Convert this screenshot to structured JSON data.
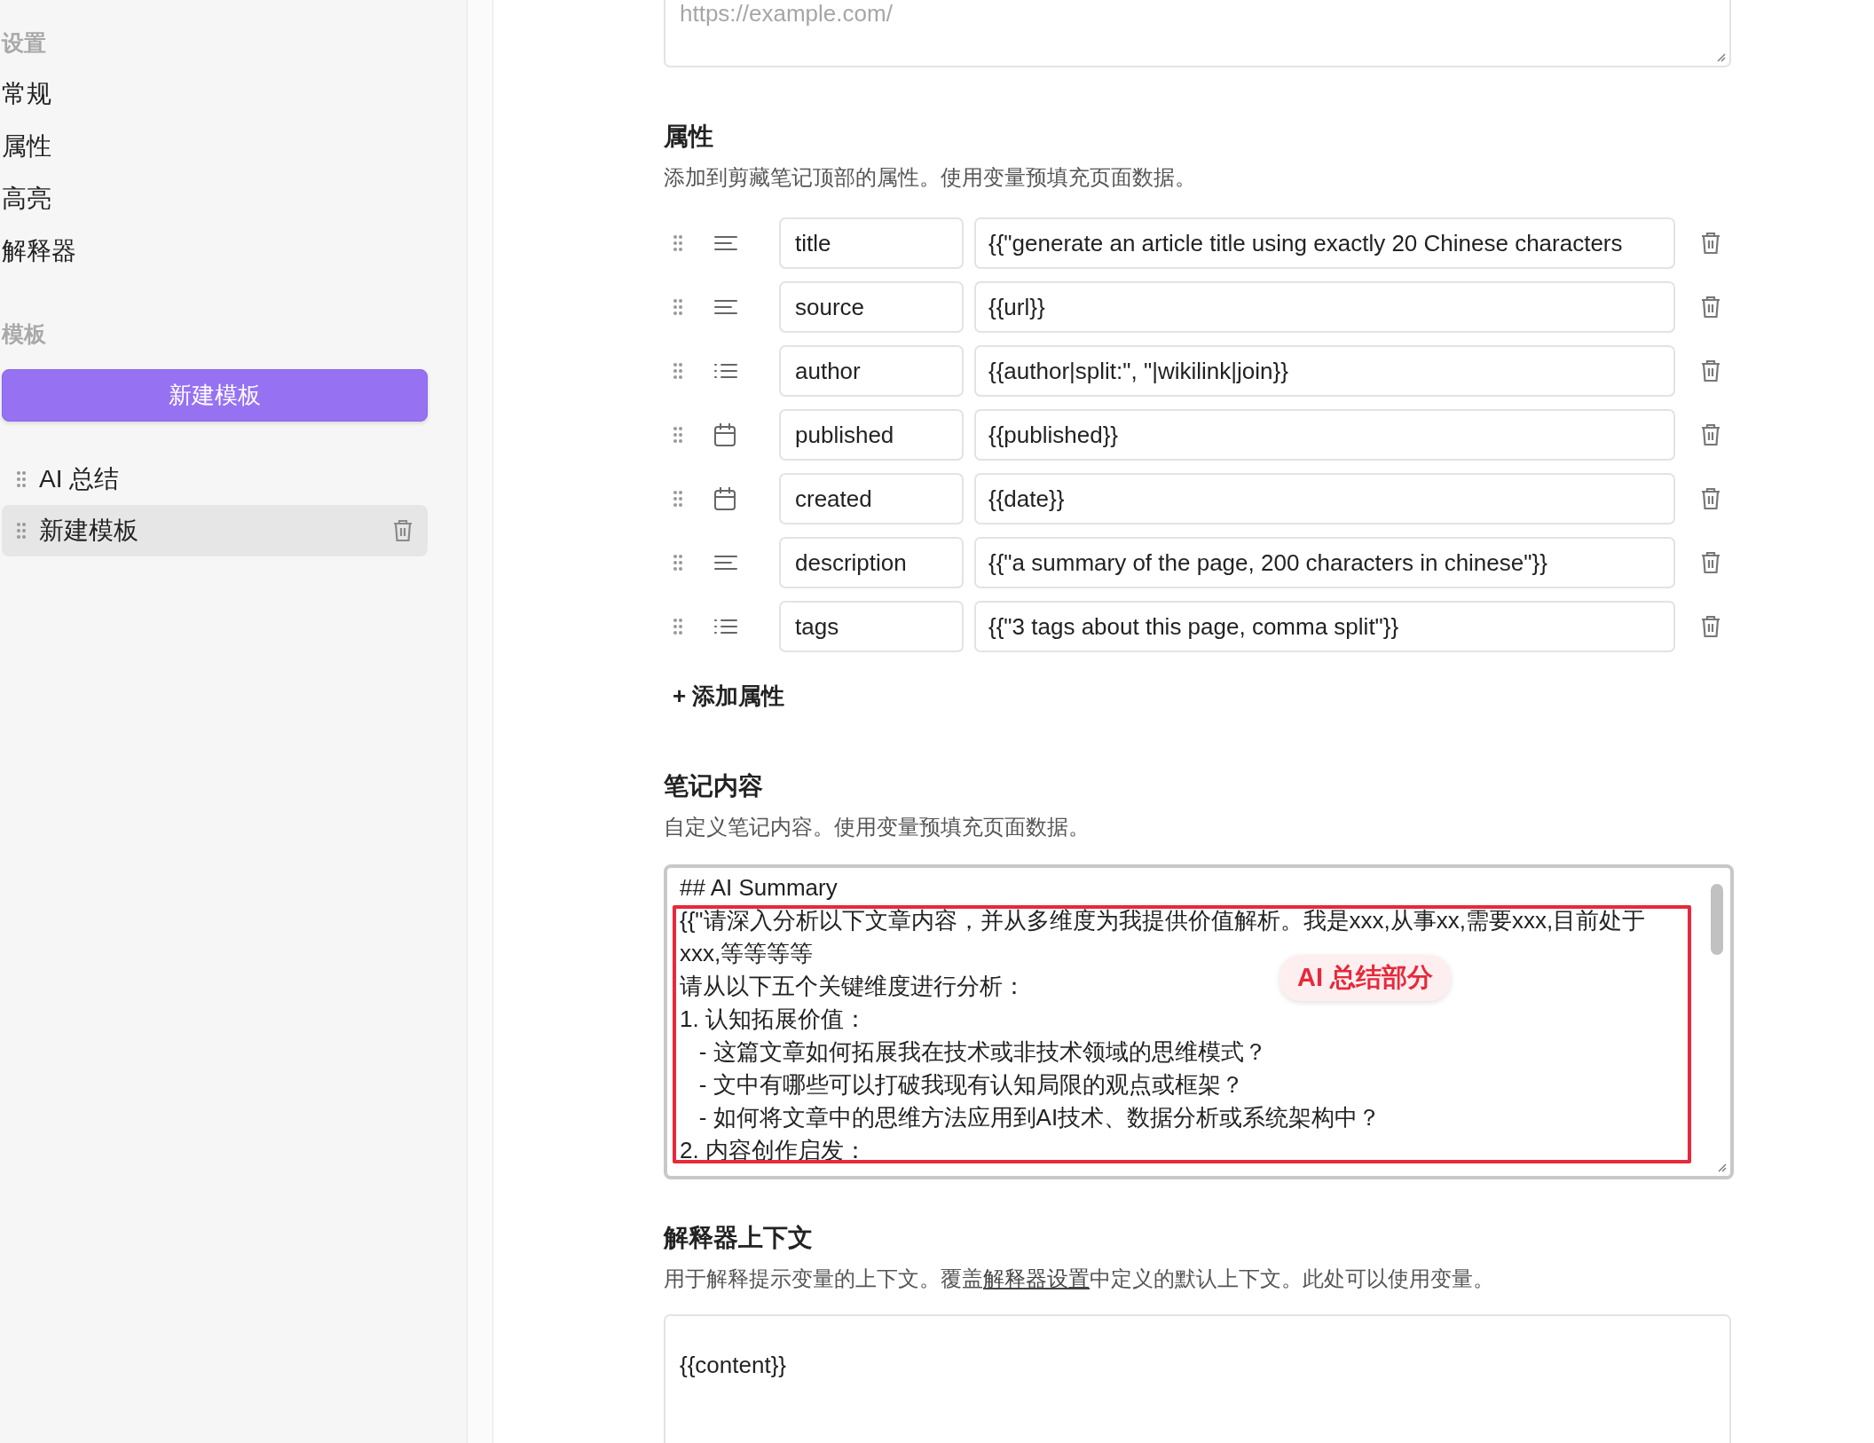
{
  "sidebar": {
    "sections": [
      {
        "heading": "设置",
        "items": [
          {
            "label": "常规"
          },
          {
            "label": "属性"
          },
          {
            "label": "高亮"
          },
          {
            "label": "解释器"
          }
        ]
      },
      {
        "heading": "模板"
      }
    ],
    "new_template_button": "新建模板",
    "templates": [
      {
        "label": "AI 总结",
        "selected": false
      },
      {
        "label": "新建模板",
        "selected": true
      }
    ]
  },
  "url_field": {
    "placeholder": "https://example.com/"
  },
  "properties": {
    "title": "属性",
    "description": "添加到剪藏笔记顶部的属性。使用变量预填充页面数据。",
    "rows": [
      {
        "kind": "text",
        "name": "title",
        "value": "{{\"generate an article title using exactly 20 Chinese characters"
      },
      {
        "kind": "text",
        "name": "source",
        "value": "{{url}}"
      },
      {
        "kind": "list",
        "name": "author",
        "value": "{{author|split:\", \"|wikilink|join}}"
      },
      {
        "kind": "date",
        "name": "published",
        "value": "{{published}}"
      },
      {
        "kind": "date",
        "name": "created",
        "value": "{{date}}"
      },
      {
        "kind": "text",
        "name": "description",
        "value": "{{\"a summary of the page, 200 characters in chinese\"}}"
      },
      {
        "kind": "list",
        "name": "tags",
        "value": "{{\"3 tags about this page, comma split\"}}"
      }
    ],
    "add_button": "+ 添加属性"
  },
  "note_content": {
    "title": "笔记内容",
    "description": "自定义笔记内容。使用变量预填充页面数据。",
    "lines": [
      "## AI Summary",
      "{{\"请深入分析以下文章内容，并从多维度为我提供价值解析。我是xxx,从事xx,需要xxx,目前处于xxx,等等等等",
      "请从以下五个关键维度进行分析：",
      "1. 认知拓展价值：",
      "   - 这篇文章如何拓展我在技术或非技术领域的思维模式？",
      "   - 文中有哪些可以打破我现有认知局限的观点或框架？",
      "   - 如何将文章中的思维方法应用到AI技术、数据分析或系统架构中？",
      "2. 内容创作启发："
    ],
    "annotation": "AI 总结部分"
  },
  "interpreter_context": {
    "title": "解释器上下文",
    "description_before": "用于解释提示变量的上下文。覆盖",
    "description_link": "解释器设置",
    "description_after": "中定义的默认上下文。此处可以使用变量。",
    "value": "{{content}}"
  }
}
